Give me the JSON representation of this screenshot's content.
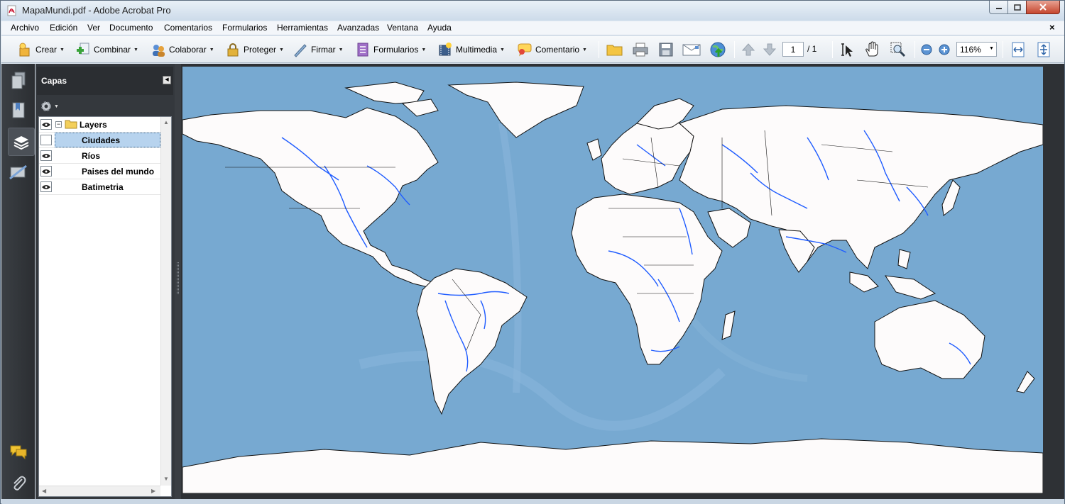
{
  "window": {
    "title": "MapaMundi.pdf - Adobe Acrobat Pro"
  },
  "menubar": {
    "items": [
      "Archivo",
      "Edición",
      "Ver",
      "Documento",
      "Comentarios",
      "Formularios",
      "Herramientas",
      "Avanzadas",
      "Ventana",
      "Ayuda"
    ],
    "close_glyph": "×"
  },
  "toolbar": {
    "crear": "Crear",
    "combinar": "Combinar",
    "colaborar": "Colaborar",
    "proteger": "Proteger",
    "firmar": "Firmar",
    "formularios": "Formularios",
    "multimedia": "Multimedia",
    "comentario": "Comentario",
    "page_current": "1",
    "page_total": "/ 1",
    "zoom": "116%"
  },
  "layers_panel": {
    "title": "Capas",
    "root": "Layers",
    "layers": [
      {
        "name": "Ciudades",
        "visible": false,
        "selected": true
      },
      {
        "name": "Ríos",
        "visible": true,
        "selected": false
      },
      {
        "name": "Paises del mundo",
        "visible": true,
        "selected": false
      },
      {
        "name": "Batimetria",
        "visible": true,
        "selected": false
      }
    ]
  },
  "icons": {
    "nav": [
      "pages-icon",
      "bookmarks-icon",
      "layers-icon",
      "model-tree-icon",
      "comments-icon",
      "attachments-icon"
    ]
  },
  "colors": {
    "ocean": "#7aabd2",
    "land": "#fdfbfb",
    "rivers": "#1f5cff",
    "panel_dark": "#34383d",
    "selection": "#b7d3ee"
  }
}
